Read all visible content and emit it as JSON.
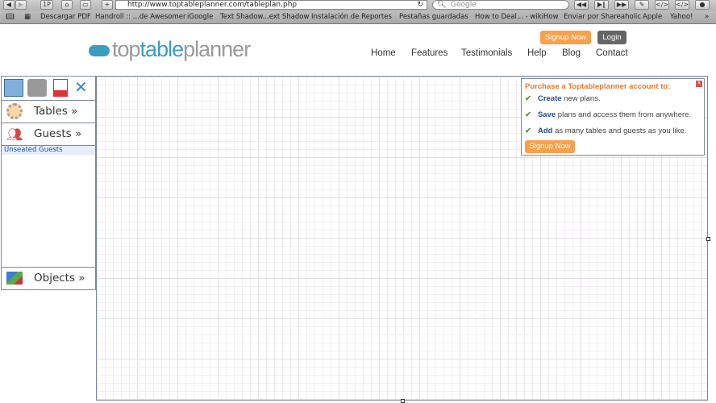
{
  "browser": {
    "url": "http://www.toptableplanner.com/tableplan.php",
    "search_placeholder": "Google",
    "pp": "1P",
    "bookmarks": [
      "Descargar PDF",
      "Handroll :: ...de Awesomer",
      "iGoogle",
      "Text Shadow...ext Shadow",
      "Instalación de Reportes",
      "Pestañas guardadas",
      "How to Deal... - wikiHow",
      "Enviar por Shareaholic",
      "Apple",
      "Yahoo!"
    ]
  },
  "header": {
    "logo": {
      "left": "top",
      "mid": "table",
      "right": "planner"
    },
    "signup": "Signup Now",
    "login": "Login",
    "nav": [
      "Home",
      "Features",
      "Testimonials",
      "Help",
      "Blog",
      "Contact"
    ]
  },
  "sidebar": {
    "tables": "Tables »",
    "guests": "Guests »",
    "unseated": "Unseated Guests",
    "objects": "Objects »"
  },
  "popup": {
    "title": "Purchase a Toptableplanner account to:",
    "items": [
      {
        "bold": "Create",
        "rest": " new plans."
      },
      {
        "bold": "Save",
        "rest": " plans and access them from anywhere."
      },
      {
        "bold": "Add",
        "rest": " as many tables and guests as you like."
      }
    ],
    "signup": "Signup Now"
  },
  "colors": {
    "accent": "#f9a04b",
    "brand": "#3d9cc1"
  }
}
